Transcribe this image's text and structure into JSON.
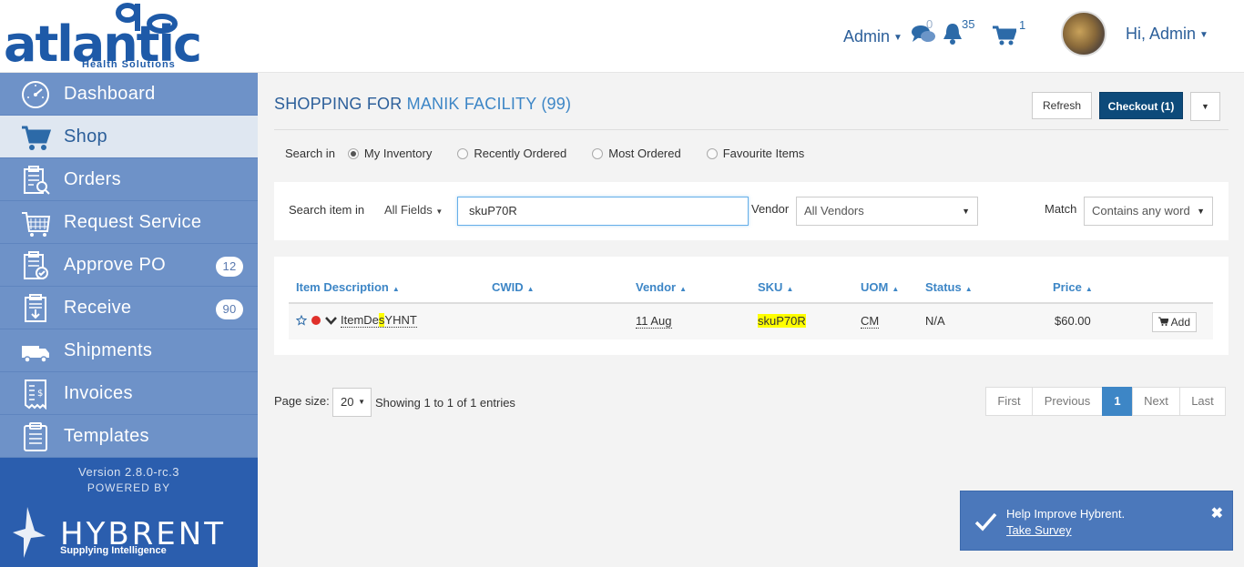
{
  "header": {
    "logo_text": "atlantic",
    "logo_subtext": "Health Solutions",
    "admin_menu": "Admin",
    "messages_count": "0",
    "notifications_count": "35",
    "cart_count": "1",
    "greeting": "Hi, Admin"
  },
  "sidebar": {
    "items": [
      {
        "label": "Dashboard",
        "icon": "dashboard-icon"
      },
      {
        "label": "Shop",
        "icon": "cart-icon"
      },
      {
        "label": "Orders",
        "icon": "orders-icon"
      },
      {
        "label": "Request Service",
        "icon": "request-service-icon"
      },
      {
        "label": "Approve PO",
        "icon": "approve-po-icon",
        "badge": "12"
      },
      {
        "label": "Receive",
        "icon": "receive-icon",
        "badge": "90"
      },
      {
        "label": "Shipments",
        "icon": "truck-icon"
      },
      {
        "label": "Invoices",
        "icon": "invoice-icon"
      },
      {
        "label": "Templates",
        "icon": "templates-icon"
      }
    ],
    "version": "Version 2.8.0-rc.3",
    "powered_by": "POWERED BY",
    "brand": "HYBRENT",
    "tagline": "Supplying Intelligence"
  },
  "main": {
    "title_prefix": "SHOPPING FOR",
    "facility": "MANIK FACILITY (99)",
    "refresh_label": "Refresh",
    "checkout_label": "Checkout (1)",
    "search_in": {
      "label": "Search in",
      "options": [
        "My Inventory",
        "Recently Ordered",
        "Most Ordered",
        "Favourite Items"
      ],
      "selected": "My Inventory"
    },
    "search": {
      "label": "Search item in",
      "fields_select": "All Fields",
      "query": "skuP70R",
      "vendor_label": "Vendor",
      "vendor_select": "All Vendors",
      "match_label": "Match",
      "match_select": "Contains any word"
    },
    "table": {
      "columns": [
        "Item Description",
        "CWID",
        "Vendor",
        "SKU",
        "UOM",
        "Status",
        "Price"
      ],
      "rows": [
        {
          "description_pre": "ItemDe",
          "description_hl": "s",
          "description_post": "YHNT",
          "cwid": "",
          "vendor": "11 Aug",
          "sku": "skuP70R",
          "uom": "CM",
          "status": "N/A",
          "price": "$60.00",
          "add_label": "Add"
        }
      ]
    },
    "pagination": {
      "page_size_label": "Page size:",
      "page_size": "20",
      "showing": "Showing 1 to 1 of 1 entries",
      "first": "First",
      "previous": "Previous",
      "current": "1",
      "next": "Next",
      "last": "Last"
    }
  },
  "toast": {
    "message": "Help Improve Hybrent.",
    "link": "Take Survey"
  },
  "colors": {
    "brand_blue": "#1e5aa8",
    "sidebar_bg": "#2b5eae",
    "nav_item_bg": "#6e92c8",
    "active_nav_bg": "#dfe7f1",
    "link_blue": "#3d86c6",
    "checkout_bg": "#0d4a7a",
    "highlight": "#ffff00",
    "toast_bg": "#4b78bb"
  }
}
